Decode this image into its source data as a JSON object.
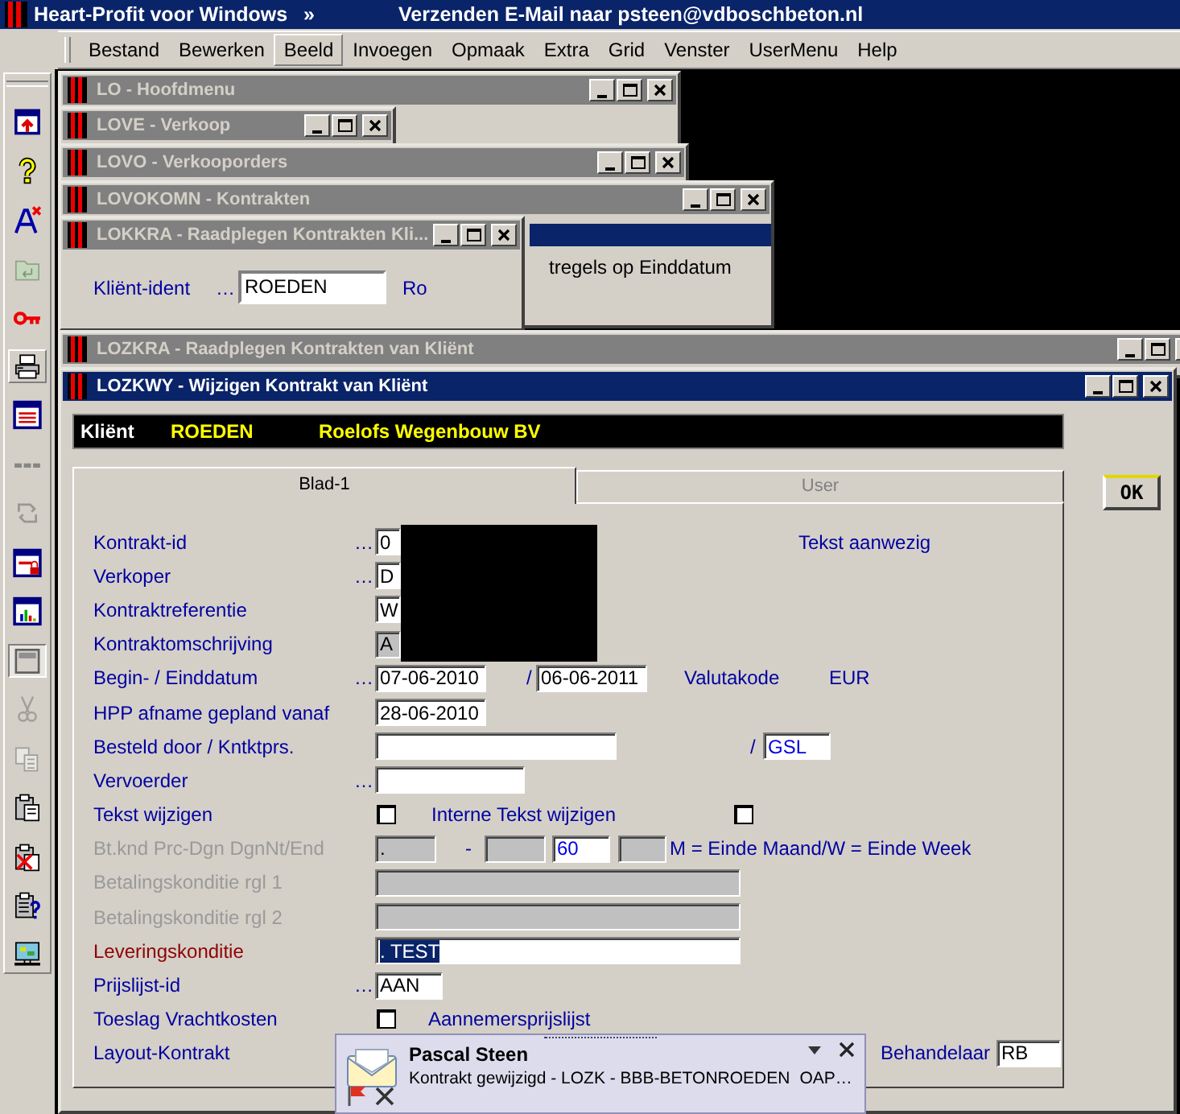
{
  "app": {
    "title": "Heart-Profit voor Windows",
    "chevron": "»",
    "status": "Verzenden E-Mail naar psteen@vdboschbeton.nl"
  },
  "menu": [
    {
      "label": "Bestand",
      "selected": false
    },
    {
      "label": "Bewerken",
      "selected": false
    },
    {
      "label": "Beeld",
      "selected": true
    },
    {
      "label": "Invoegen",
      "selected": false
    },
    {
      "label": "Opmaak",
      "selected": false
    },
    {
      "label": "Extra",
      "selected": false
    },
    {
      "label": "Grid",
      "selected": false
    },
    {
      "label": "Venster",
      "selected": false
    },
    {
      "label": "UserMenu",
      "selected": false
    },
    {
      "label": "Help",
      "selected": false
    }
  ],
  "toolbar": [
    {
      "disabled": false,
      "pressed": false,
      "raised": false
    },
    {
      "disabled": false,
      "pressed": false,
      "raised": false
    },
    {
      "disabled": false,
      "pressed": false,
      "raised": false
    },
    {
      "disabled": true,
      "pressed": false,
      "raised": false
    },
    {
      "disabled": false,
      "pressed": false,
      "raised": false
    },
    {
      "disabled": false,
      "pressed": false,
      "raised": true
    },
    {
      "disabled": false,
      "pressed": false,
      "raised": false
    },
    {
      "disabled": true,
      "pressed": false,
      "raised": false
    },
    {
      "disabled": true,
      "pressed": false,
      "raised": false
    },
    {
      "disabled": false,
      "pressed": false,
      "raised": false
    },
    {
      "disabled": false,
      "pressed": false,
      "raised": false
    },
    {
      "disabled": false,
      "pressed": true,
      "raised": false
    },
    {
      "disabled": true,
      "pressed": false,
      "raised": false
    },
    {
      "disabled": true,
      "pressed": false,
      "raised": false
    },
    {
      "disabled": false,
      "pressed": false,
      "raised": false
    },
    {
      "disabled": false,
      "pressed": false,
      "raised": false
    },
    {
      "disabled": false,
      "pressed": false,
      "raised": false
    },
    {
      "disabled": false,
      "pressed": false,
      "raised": false
    }
  ],
  "windows": [
    {
      "title": "LO - Hoofdmenu",
      "active": false
    },
    {
      "title": "LOVE - Verkoop",
      "active": false
    },
    {
      "title": "LOVO - Verkooporders",
      "active": false
    },
    {
      "title": "LOVOKOMN - Kontrakten",
      "active": false,
      "selected_row": true,
      "rows": [
        "tregels op Einddatum"
      ]
    },
    {
      "title": "LOKKRA - Raadplegen Kontrakten Kli...",
      "active": false,
      "fields": [
        {
          "label": "Kliënt-ident",
          "lookup": "…",
          "value": "ROEDEN",
          "after": "Ro"
        }
      ]
    },
    {
      "title": "LOZKRA - Raadplegen Kontrakten van Kliënt",
      "active": false
    },
    {
      "title": "LOZKWY - Wijzigen Kontrakt van Kliënt",
      "active": true,
      "client": {
        "label": "Kliënt",
        "code": "ROEDEN",
        "name": "Roelofs Wegenbouw BV"
      },
      "ok": "OK",
      "tabs": [
        {
          "label": "Blad-1",
          "selected": true
        },
        {
          "label": "User",
          "selected": false
        }
      ],
      "form": {
        "rows": [
          {
            "label": "Kontrakt-id",
            "lookup": "…",
            "disabled": false,
            "required": false,
            "redacted": true,
            "items": [
              {
                "kind": "input",
                "value": "0",
                "disabled": false,
                "readonly": false
              },
              {
                "kind": "text",
                "text": "Tekst aanwezig"
              }
            ]
          },
          {
            "label": "Verkoper",
            "lookup": "…",
            "disabled": false,
            "required": false,
            "redacted": true,
            "items": [
              {
                "kind": "input",
                "value": "D",
                "disabled": false,
                "readonly": false
              }
            ]
          },
          {
            "label": "Kontraktreferentie",
            "disabled": false,
            "required": false,
            "redacted": true,
            "items": [
              {
                "kind": "input",
                "value": "W",
                "disabled": false,
                "readonly": false
              }
            ]
          },
          {
            "label": "Kontraktomschrijving",
            "disabled": false,
            "required": false,
            "redacted": true,
            "items": [
              {
                "kind": "input",
                "value": "A",
                "disabled": true,
                "readonly": false
              }
            ]
          },
          {
            "label": "Begin- / Einddatum",
            "lookup": "…",
            "disabled": false,
            "required": false,
            "items": [
              {
                "kind": "input",
                "value": "07-06-2010",
                "disabled": false,
                "readonly": false
              },
              {
                "kind": "text",
                "text": "/"
              },
              {
                "kind": "input",
                "value": "06-06-2011",
                "disabled": false,
                "readonly": false
              },
              {
                "kind": "text",
                "text": "Valutakode"
              },
              {
                "kind": "text",
                "text": "EUR"
              }
            ]
          },
          {
            "label": "HPP afname gepland vanaf",
            "disabled": false,
            "required": false,
            "items": [
              {
                "kind": "input",
                "value": "28-06-2010",
                "disabled": false,
                "readonly": false
              }
            ]
          },
          {
            "label": "Besteld door / Kntktprs.",
            "disabled": false,
            "required": false,
            "items": [
              {
                "kind": "input",
                "disabled": false
              },
              {
                "kind": "text",
                "text": "/"
              },
              {
                "kind": "input",
                "value": "GSL",
                "disabled": false,
                "readonly": true
              }
            ]
          },
          {
            "label": "Vervoerder",
            "lookup": "…",
            "disabled": false,
            "required": false,
            "items": [
              {
                "kind": "input",
                "disabled": false
              }
            ]
          },
          {
            "label": "Tekst wijzigen",
            "disabled": false,
            "required": false,
            "items": [
              {
                "kind": "checkbox",
                "checked": false
              },
              {
                "kind": "text",
                "text": "Interne Tekst wijzigen"
              },
              {
                "kind": "checkbox",
                "checked": false
              }
            ]
          },
          {
            "label": "Bt.knd Prc-Dgn DgnNt/End",
            "disabled": true,
            "required": false,
            "items": [
              {
                "kind": "input",
                "value": ".",
                "disabled": true,
                "readonly": false
              },
              {
                "kind": "text",
                "text": "-"
              },
              {
                "kind": "input",
                "disabled": true
              },
              {
                "kind": "input",
                "value": "60",
                "disabled": false,
                "readonly": true
              },
              {
                "kind": "input",
                "disabled": true
              },
              {
                "kind": "text",
                "text": "M = Einde Maand/W = Einde Week"
              }
            ]
          },
          {
            "label": "Betalingskonditie rgl 1",
            "disabled": true,
            "required": false,
            "items": [
              {
                "kind": "input",
                "disabled": true
              }
            ]
          },
          {
            "label": "Betalingskonditie rgl 2",
            "disabled": true,
            "required": false,
            "items": [
              {
                "kind": "input",
                "disabled": true
              }
            ]
          },
          {
            "label": "Leveringskonditie",
            "disabled": false,
            "required": true,
            "items": [
              {
                "kind": "input",
                "value": ". TEST",
                "disabled": false,
                "text_selected": true
              }
            ]
          },
          {
            "label": "Prijslijst-id",
            "lookup": "…",
            "disabled": false,
            "required": false,
            "items": [
              {
                "kind": "input",
                "value": "AAN",
                "disabled": false,
                "readonly": false
              }
            ]
          },
          {
            "label": "Toeslag Vrachtkosten",
            "disabled": false,
            "required": false,
            "items": [
              {
                "kind": "checkbox",
                "checked": false
              },
              {
                "kind": "text",
                "text": "Aannemersprijslijst"
              }
            ]
          },
          {
            "label": "Layout-Kontrakt",
            "disabled": false,
            "required": false,
            "items": [
              {
                "kind": "text",
                "text": "Behandelaar"
              },
              {
                "kind": "input",
                "value": "RB",
                "disabled": false,
                "readonly": false
              }
            ]
          }
        ]
      }
    }
  ],
  "notification": {
    "sender": "Pascal Steen",
    "message": "Kontrakt gewijzigd - LOZK - BBB-BETONROEDEN",
    "extra": "OAP…"
  }
}
